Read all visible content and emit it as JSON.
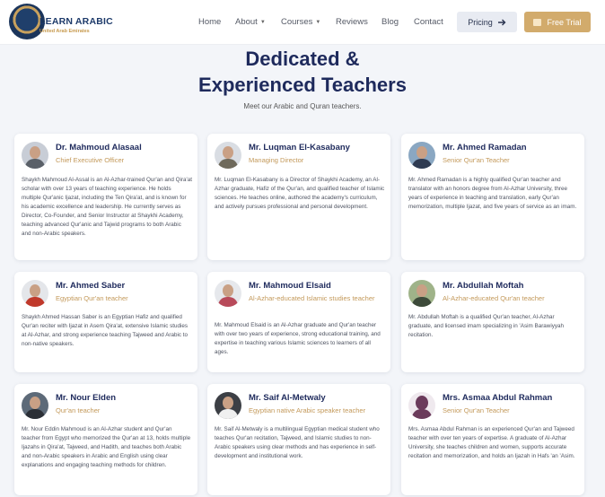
{
  "brand": {
    "title": "LEARN ARABIC",
    "subtitle": "United Arab Emirates"
  },
  "nav": {
    "home": "Home",
    "about": "About",
    "courses": "Courses",
    "reviews": "Reviews",
    "blog": "Blog",
    "contact": "Contact",
    "pricing": "Pricing",
    "free_trial": "Free Trial"
  },
  "section": {
    "title_line1": "Dedicated &",
    "title_line2": "Experienced Teachers",
    "subtitle": "Meet our Arabic and Quran teachers."
  },
  "teachers": [
    {
      "name": "Dr. Mahmoud Alasaal",
      "role": "Chief Executive Officer",
      "bio": "Shaykh Mahmoud Al-Assal is an Al-Azhar-trained Qur'an and Qira'at scholar with over 13 years of teaching experience. He holds multiple Qur'anic Ijazat, including the Ten Qira'at, and is known for his academic excellence and leadership. He currently serves as Director, Co-Founder, and Senior Instructor at Shaykhi Academy, teaching advanced Qur'anic and Tajwid programs to both Arabic and non-Arabic speakers."
    },
    {
      "name": "Mr. Luqman El-Kasabany",
      "role": "Managing Director",
      "bio": "Mr. Luqman El-Kasabany is a Director of Shaykhi Academy, an Al-Azhar graduate, Hafiz of the Qur'an, and qualified teacher of Islamic sciences. He teaches online, authored the academy's curriculum, and actively pursues professional and personal development."
    },
    {
      "name": "Mr. Ahmed Ramadan",
      "role": "Senior Qur'an Teacher",
      "bio": "Mr. Ahmed Ramadan is a highly qualified Qur'an teacher and translator with an honors degree from Al-Azhar University, three years of experience in teaching and translation, early Qur'an memorization, multiple Ijazat, and five years of service as an imam."
    },
    {
      "name": "Mr. Ahmed Saber",
      "role": "Egyptian Qur'an teacher",
      "bio": "Shaykh Ahmed Hassan Saber is an Egyptian Hafiz and qualified Qur'an reciter with Ijazat in Asem Qira'at, extensive Islamic studies at Al-Azhar, and strong experience teaching Tajweed and Arabic to non-native speakers."
    },
    {
      "name": "Mr. Mahmoud Elsaid",
      "role": "Al-Azhar-educated Islamic studies teacher",
      "bio": "Mr. Mahmoud Elsaid is an Al-Azhar graduate and Qur'an teacher with over two years of experience, strong educational training, and expertise in teaching various Islamic sciences to learners of all ages."
    },
    {
      "name": "Mr. Abdullah Moftah",
      "role": "Al-Azhar-educated Qur'an teacher",
      "bio": "Mr. Abdullah Moftah is a qualified Qur'an teacher, Al-Azhar graduate, and licensed imam specializing in 'Asim Barawiyyah recitation."
    },
    {
      "name": "Mr. Nour Elden",
      "role": "Qur'an teacher",
      "bio": "Mr. Nour Eddin Mahmoud is an Al-Azhar student and Qur'an teacher from Egypt who memorized the Qur'an at 13, holds multiple Ijazahs in Qira'at, Tajweed, and Hadith, and teaches both Arabic and non-Arabic speakers in Arabic and English using clear explanations and engaging teaching methods for children."
    },
    {
      "name": "Mr. Saif Al-Metwaly",
      "role": "Egyptian native Arabic speaker teacher",
      "bio": "Mr. Saif Al-Metwaly is a multilingual Egyptian medical student who teaches Qur'an recitation, Tajweed, and Islamic studies to non-Arabic speakers using clear methods and has experience in self-development and institutional work."
    },
    {
      "name": "Mrs. Asmaa Abdul Rahman",
      "role": "Senior Qur'an Teacher",
      "bio": "Mrs. Asmaa Abdul Rahman is an experienced Qur'an and Tajweed teacher with over ten years of expertise. A graduate of Al-Azhar University, she teaches children and women, supports accurate recitation and memorization, and holds an Ijazah in Hafs 'an 'Asim."
    }
  ],
  "colors": {
    "navy": "#1e2a5c",
    "gold": "#c3995a",
    "trial_button": "#d2ab6c",
    "pricing_button": "#e8ebf2",
    "page_bg": "#f3f5f9"
  },
  "icons": {
    "pricing": "arrow-right-icon",
    "free_trial": "gift-icon",
    "dropdown": "caret-down-icon"
  }
}
